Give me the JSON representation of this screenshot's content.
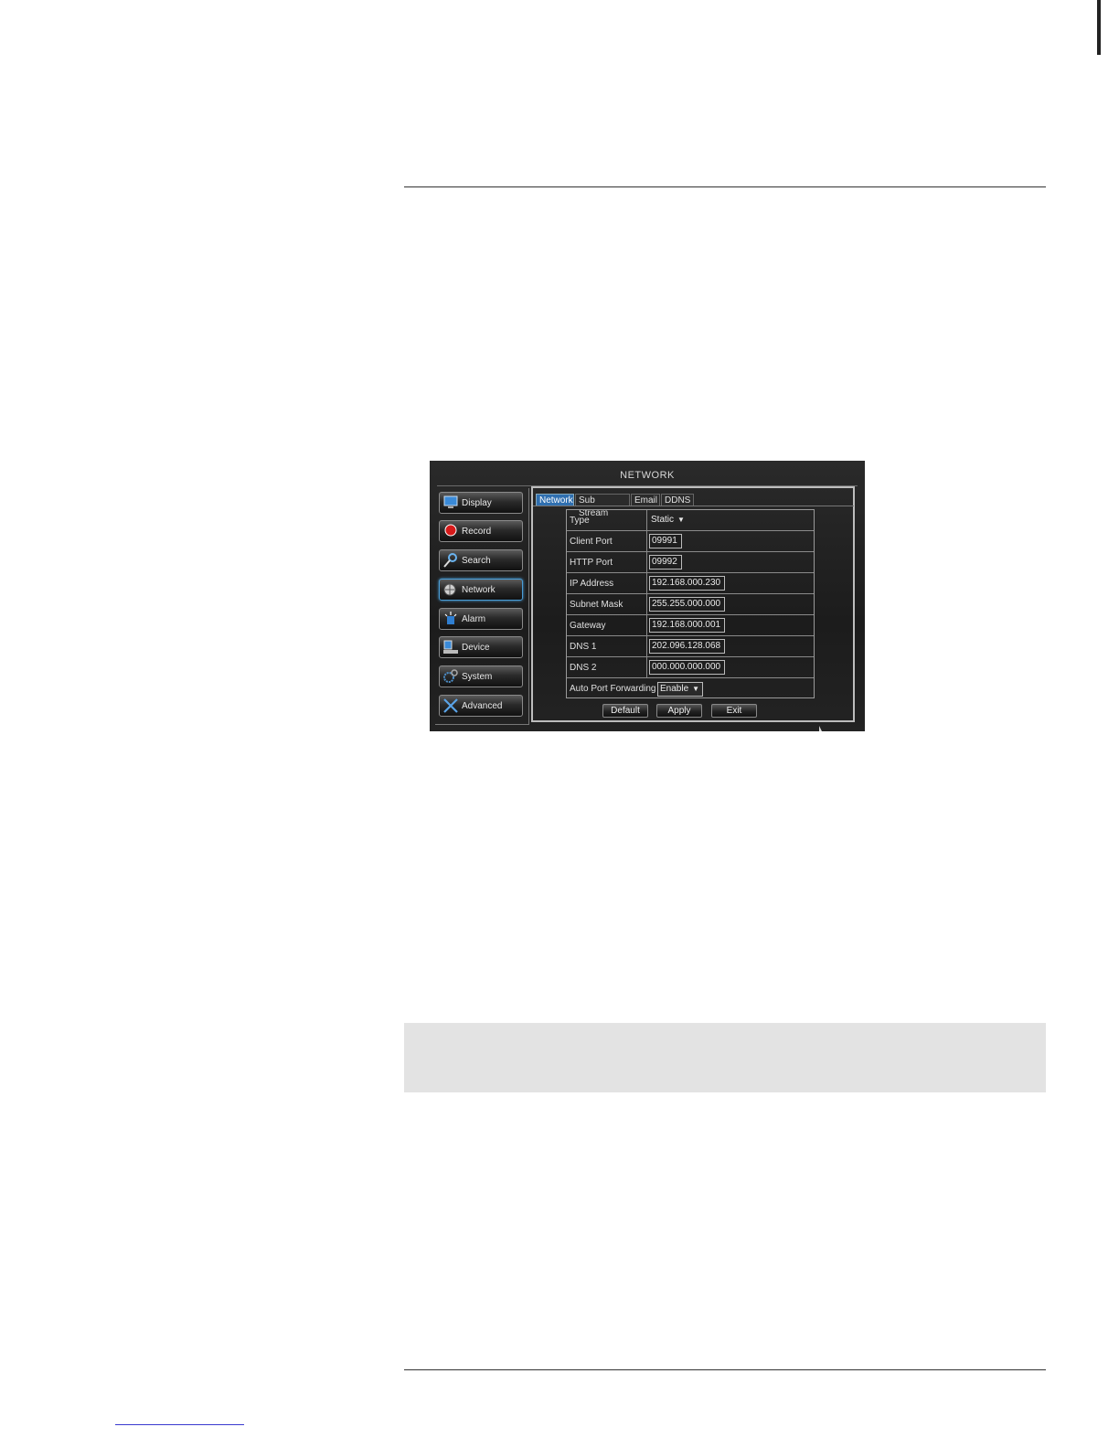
{
  "dvr": {
    "title": "NETWORK",
    "sidebar": [
      {
        "label": "Display",
        "icon": "monitor-icon"
      },
      {
        "label": "Record",
        "icon": "record-icon"
      },
      {
        "label": "Search",
        "icon": "magnifier-icon"
      },
      {
        "label": "Network",
        "icon": "globe-icon",
        "active": true
      },
      {
        "label": "Alarm",
        "icon": "alarm-icon"
      },
      {
        "label": "Device",
        "icon": "device-icon"
      },
      {
        "label": "System",
        "icon": "gears-icon"
      },
      {
        "label": "Advanced",
        "icon": "tools-icon"
      }
    ],
    "tabs": [
      "Network",
      "Sub Stream",
      "Email",
      "DDNS"
    ],
    "active_tab": "Network",
    "fields": {
      "type": {
        "label": "Type",
        "value": "Static"
      },
      "client_port": {
        "label": "Client Port",
        "value": "09991"
      },
      "http_port": {
        "label": "HTTP Port",
        "value": "09992"
      },
      "ip_address": {
        "label": "IP Address",
        "value": "192.168.000.230"
      },
      "subnet_mask": {
        "label": "Subnet Mask",
        "value": "255.255.000.000"
      },
      "gateway": {
        "label": "Gateway",
        "value": "192.168.000.001"
      },
      "dns1": {
        "label": "DNS 1",
        "value": "202.096.128.068"
      },
      "dns2": {
        "label": "DNS 2",
        "value": "000.000.000.000"
      },
      "auto_port_forwarding": {
        "label": "Auto Port Forwarding",
        "value": "Enable"
      }
    },
    "buttons": {
      "default": "Default",
      "apply": "Apply",
      "exit": "Exit"
    }
  }
}
